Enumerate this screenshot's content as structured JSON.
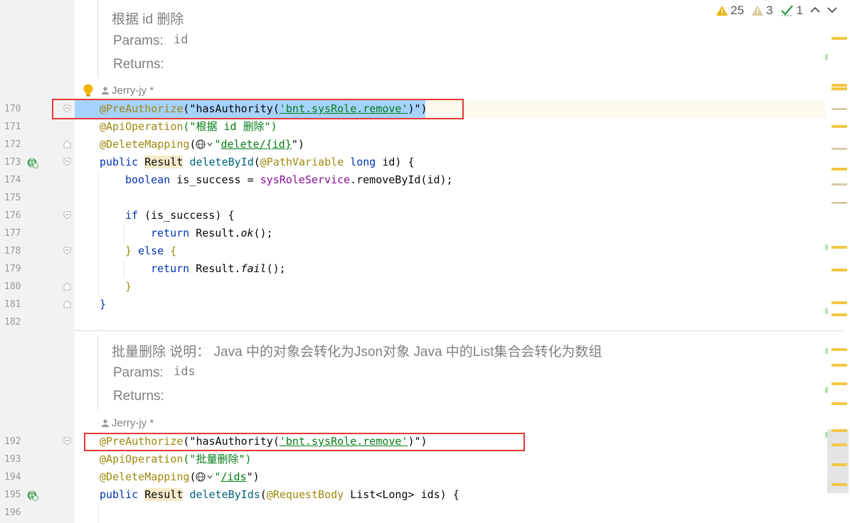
{
  "inspections": {
    "warnings": "25",
    "weak_warnings": "3",
    "ok": "1"
  },
  "doc1": {
    "title": "根据 id 删除",
    "params_label": "Params:",
    "params_value": "id",
    "returns_label": "Returns:",
    "author": "Jerry-jy *"
  },
  "doc2": {
    "title": "批量删除 说明： Java 中的对象会转化为Json对象 Java 中的List集合会转化为数组",
    "params_label": "Params:",
    "params_value": "ids",
    "returns_label": "Returns:",
    "author": "Jerry-jy *"
  },
  "line_numbers": [
    "170",
    "171",
    "172",
    "173",
    "174",
    "175",
    "176",
    "177",
    "178",
    "179",
    "180",
    "181",
    "182",
    "192",
    "193",
    "194",
    "195",
    "196"
  ],
  "code": {
    "l170": {
      "ann": "@PreAuthorize",
      "p1": "(\"",
      "s1": "hasAuthority(",
      "s2": "'bnt.sysRole.remove'",
      "s3": ")\")"
    },
    "l171": {
      "ann": "@ApiOperation",
      "s": "(\"根据 id 删除\")"
    },
    "l172": {
      "ann": "@DeleteMapping",
      "p1": "(",
      "p2": "\"",
      "s": "delete/{id}",
      "p3": "\")"
    },
    "l173": {
      "kw": "public",
      "type": "Result",
      "m": "deleteById",
      "p1": "(",
      "ann": "@PathVariable",
      "kw2": "long",
      "rest": "id) {"
    },
    "l174": {
      "kw": "boolean",
      "v": "is_success",
      "eq": " = ",
      "f": "sysRoleService",
      "rest": ".removeById(id);"
    },
    "l176": {
      "kw": "if",
      "rest": " (is_success) {"
    },
    "l177": {
      "kw": "return",
      "cls": "Result.",
      "m": "ok",
      "rest": "();"
    },
    "l178": {
      "b": "}",
      "kw": "else",
      "rest": "{"
    },
    "l179": {
      "kw": "return",
      "cls": "Result.",
      "m": "fail",
      "rest": "();"
    },
    "l180": {
      "b": "}"
    },
    "l181": {
      "b": "}"
    },
    "l192": {
      "ann": "@PreAuthorize",
      "p1": "(\"",
      "s1": "hasAuthority(",
      "s2": "'bnt.sysRole.remove'",
      "s3": ")\")"
    },
    "l193": {
      "ann": "@ApiOperation",
      "s": "(\"批量删除\")"
    },
    "l194": {
      "ann": "@DeleteMapping",
      "p1": "(",
      "p2": "\"",
      "s": "/ids",
      "p3": "\")"
    },
    "l195": {
      "kw": "public",
      "type": "Result",
      "m": "deleteByIds",
      "p1": "(",
      "ann": "@RequestBody",
      "t2": "List<Long>",
      "rest": "ids) {"
    }
  },
  "colors": {
    "warning": "#e8b400",
    "selection": "#a6d2ff",
    "highlight_box": "#e53935"
  }
}
